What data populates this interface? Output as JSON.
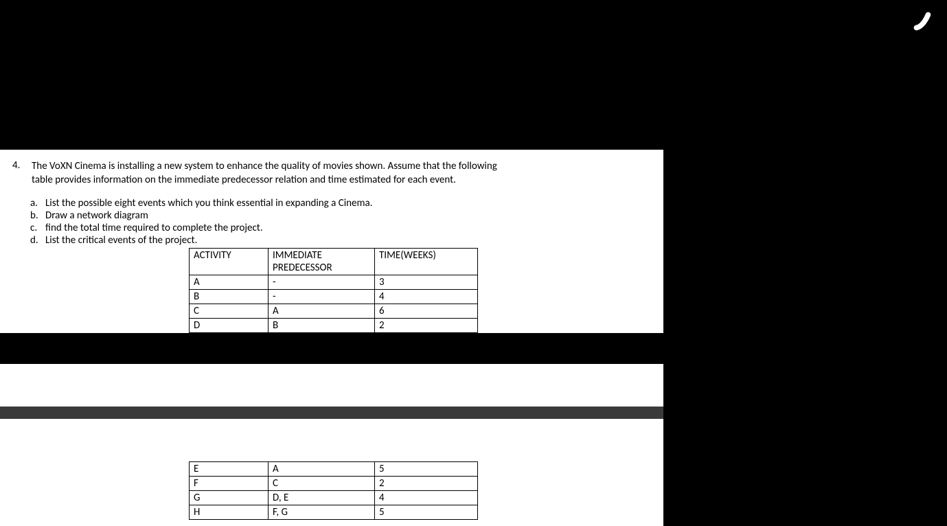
{
  "question": {
    "number": "4.",
    "text_line1": "The VoXN Cinema is installing a new system to enhance the quality of movies shown. Assume that the following",
    "text_line2": "table provides information on the immediate predecessor relation and time estimated for each event."
  },
  "subs": {
    "a": {
      "letter": "a.",
      "text": "List the possible eight events which you think essential in expanding a Cinema."
    },
    "b": {
      "letter": "b.",
      "text": "Draw a network diagram"
    },
    "c": {
      "letter": "c.",
      "text": "find the total time required to complete the project."
    },
    "d": {
      "letter": "d.",
      "text": "List the critical events of the project."
    }
  },
  "table_headers": {
    "activity": "ACTIVITY",
    "predecessor_l1": "IMMEDIATE",
    "predecessor_l2": "PREDECESSOR",
    "time": "TIME(WEEKS)"
  },
  "upper_rows": [
    {
      "activity": "A",
      "predecessor": "-",
      "time": "3"
    },
    {
      "activity": "B",
      "predecessor": "-",
      "time": "4"
    },
    {
      "activity": "C",
      "predecessor": "A",
      "time": "6"
    },
    {
      "activity": "D",
      "predecessor": "B",
      "time": "2"
    }
  ],
  "lower_rows": [
    {
      "activity": "E",
      "predecessor": "A",
      "time": "5"
    },
    {
      "activity": "F",
      "predecessor": "C",
      "time": "2"
    },
    {
      "activity": "G",
      "predecessor": "D, E",
      "time": "4"
    },
    {
      "activity": "H",
      "predecessor": "F, G",
      "time": "5"
    }
  ],
  "chart_data": {
    "type": "table",
    "title": "Activity / Immediate Predecessor / Time (weeks)",
    "columns": [
      "ACTIVITY",
      "IMMEDIATE PREDECESSOR",
      "TIME(WEEKS)"
    ],
    "rows": [
      [
        "A",
        "-",
        3
      ],
      [
        "B",
        "-",
        4
      ],
      [
        "C",
        "A",
        6
      ],
      [
        "D",
        "B",
        2
      ],
      [
        "E",
        "A",
        5
      ],
      [
        "F",
        "C",
        2
      ],
      [
        "G",
        "D, E",
        4
      ],
      [
        "H",
        "F, G",
        5
      ]
    ]
  }
}
